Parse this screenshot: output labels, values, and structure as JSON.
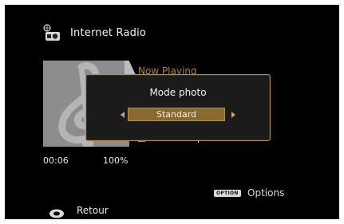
{
  "header": {
    "title": "Internet Radio",
    "icon": "internet-radio-icon"
  },
  "now_playing": {
    "label": "Now Playing",
    "format": "MP3 128kbps"
  },
  "playback": {
    "time": "00:06",
    "percent": "100%"
  },
  "modal": {
    "title": "Mode photo",
    "selected_value": "Standard"
  },
  "footer": {
    "option_badge": "OPTION",
    "options_label": "Options",
    "back_label": "Retour"
  },
  "colors": {
    "accent": "#b08c52",
    "selector_bg": "#8a6a2f",
    "background": "#000000"
  }
}
